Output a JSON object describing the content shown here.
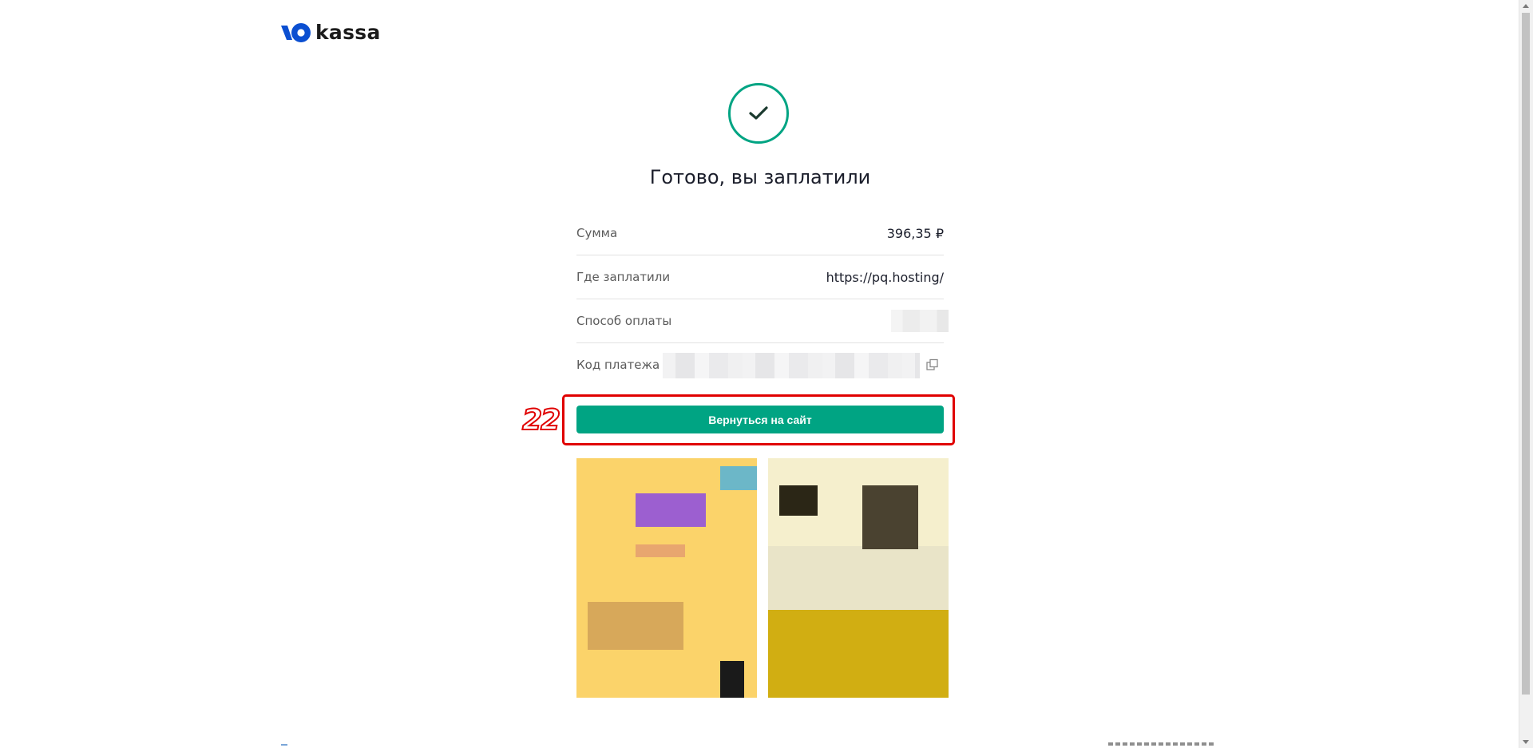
{
  "brand": {
    "name": "kassa",
    "color": "#0070f0",
    "icon": "yoomoney-logo-icon"
  },
  "status": {
    "icon": "checkmark-icon",
    "color": "#00a483",
    "title": "Готово, вы заплатили"
  },
  "details": [
    {
      "label": "Сумма",
      "value": "396,35 ₽"
    },
    {
      "label": "Где заплатили",
      "value": "https://pq.hosting/"
    },
    {
      "label": "Способ оплаты",
      "value": ""
    },
    {
      "label": "Код платежа",
      "value": ""
    }
  ],
  "actions": {
    "return_label": "Вернуться на сайт",
    "copy_icon": "copy-icon"
  },
  "annotation": {
    "number": "22",
    "color": "#e00000"
  }
}
